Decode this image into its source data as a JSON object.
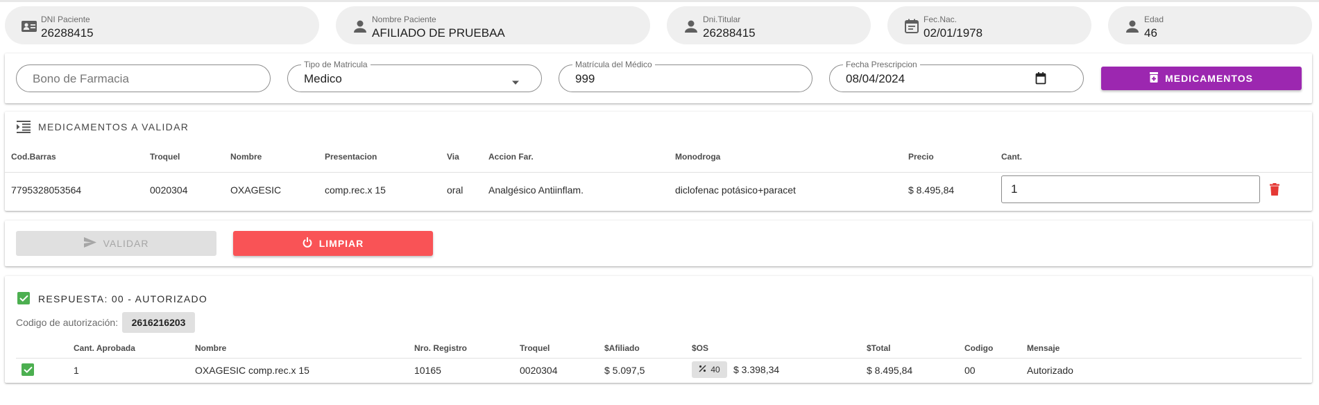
{
  "patient": {
    "dni": {
      "label": "DNI Paciente",
      "value": "26288415",
      "icon": "id-card-icon"
    },
    "nombre": {
      "label": "Nombre Paciente",
      "value": "AFILIADO DE PRUEBAA",
      "icon": "person-icon"
    },
    "dni_titular": {
      "label": "Dni.Titular",
      "value": "26288415",
      "icon": "person-icon"
    },
    "fec_nac": {
      "label": "Fec.Nac.",
      "value": "02/01/1978",
      "icon": "calendar-icon"
    },
    "edad": {
      "label": "Edad",
      "value": "46",
      "icon": "person-icon"
    }
  },
  "form": {
    "bono": {
      "placeholder": "Bono de Farmacia"
    },
    "tipo_matricula": {
      "label": "Tipo de Matricula",
      "value": "Medico"
    },
    "matricula": {
      "label": "Matrícula del Médico",
      "value": "999"
    },
    "fecha": {
      "label": "Fecha Prescripcion",
      "value": "08/04/2024"
    },
    "medicamentos_button": "MEDICAMENTOS"
  },
  "medicamentos": {
    "title": "MEDICAMENTOS A VALIDAR",
    "columns": [
      "Cod.Barras",
      "Troquel",
      "Nombre",
      "Presentacion",
      "Via",
      "Accion Far.",
      "Monodroga",
      "Precio",
      "Cant."
    ],
    "row": {
      "cod_barras": "7795328053564",
      "troquel": "0020304",
      "nombre": "OXAGESIC",
      "presentacion": "comp.rec.x 15",
      "via": "oral",
      "accion": "Analgésico Antiinflam.",
      "monodroga": "diclofenac potásico+paracet",
      "precio": "$ 8.495,84",
      "cant": "1"
    }
  },
  "actions": {
    "validar": "VALIDAR",
    "limpiar": "LIMPIAR"
  },
  "respuesta": {
    "title": "RESPUESTA: 00 - AUTORIZADO",
    "auth_label": "Codigo de autorización:",
    "auth_code": "2616216203",
    "columns": [
      "Cant. Aprobada",
      "Nombre",
      "Nro. Registro",
      "Troquel",
      "$Afiliado",
      "$OS",
      "$Total",
      "Codigo",
      "Mensaje"
    ],
    "row": {
      "cant": "1",
      "nombre": "OXAGESIC comp.rec.x 15",
      "registro": "10165",
      "troquel": "0020304",
      "afiliado": "$ 5.097,5",
      "os_pct": "40",
      "os": "$ 3.398,34",
      "total": "$ 8.495,84",
      "codigo": "00",
      "mensaje": "Autorizado"
    }
  },
  "colors": {
    "primary": "#9c27b0",
    "danger": "#f95356",
    "success": "#4caf50",
    "delete": "#e53935"
  }
}
